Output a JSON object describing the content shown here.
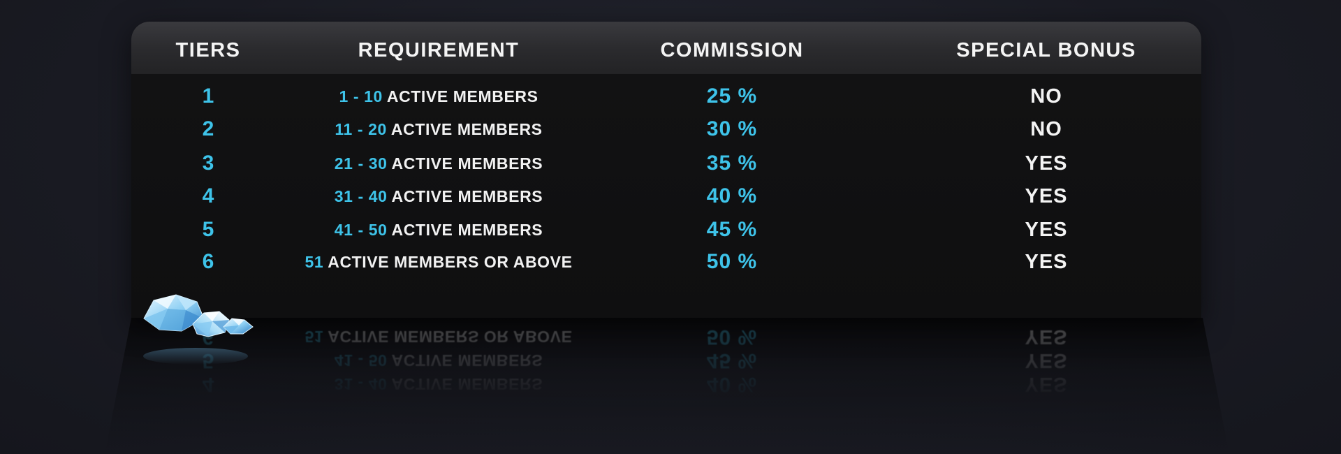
{
  "table": {
    "headers": {
      "tiers": "TIERS",
      "requirement": "REQUIREMENT",
      "commission": "COMMISSION",
      "special_bonus": "SPECIAL BONUS"
    },
    "rows": [
      {
        "tier": "1",
        "range": "1 - 10",
        "req_text": "ACTIVE MEMBERS",
        "commission": "25 %",
        "bonus": "NO"
      },
      {
        "tier": "2",
        "range": "11 - 20",
        "req_text": "ACTIVE MEMBERS",
        "commission": "30 %",
        "bonus": "NO"
      },
      {
        "tier": "3",
        "range": "21 - 30",
        "req_text": "ACTIVE MEMBERS",
        "commission": "35 %",
        "bonus": "YES"
      },
      {
        "tier": "4",
        "range": "31 - 40",
        "req_text": "ACTIVE MEMBERS",
        "commission": "40 %",
        "bonus": "YES"
      },
      {
        "tier": "5",
        "range": "41 - 50",
        "req_text": "ACTIVE MEMBERS",
        "commission": "45 %",
        "bonus": "YES"
      },
      {
        "tier": "6",
        "range": "51",
        "req_text": "ACTIVE MEMBERS OR ABOVE",
        "commission": "50 %",
        "bonus": "YES"
      }
    ]
  },
  "icons": {
    "decoration": "diamond-cluster-icon"
  },
  "colors": {
    "accent": "#3ec3e9",
    "text": "#f2f2f2",
    "header_bg": "#2b2b2e",
    "body_bg": "#101011",
    "page_bg": "#1a1b23"
  }
}
